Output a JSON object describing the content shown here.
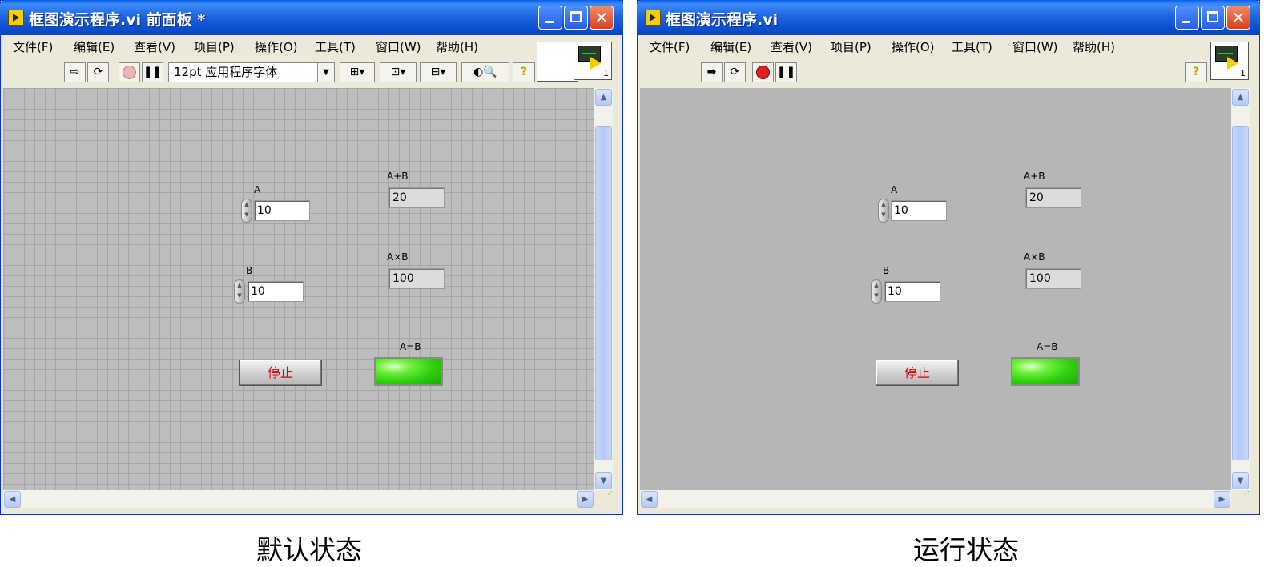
{
  "windows": [
    {
      "title": "框图演示程序.vi 前面板 *",
      "menus": [
        "文件(F)",
        "编辑(E)",
        "查看(V)",
        "项目(P)",
        "操作(O)",
        "工具(T)",
        "窗口(W)",
        "帮助(H)"
      ],
      "font_selector": "12pt 应用程序字体",
      "mode": "edit",
      "controls": {
        "a_label": "A",
        "a_value": "10",
        "b_label": "B",
        "b_value": "10",
        "sum_label": "A+B",
        "sum_value": "20",
        "product_label": "A×B",
        "product_value": "100",
        "equal_label": "A=B",
        "stop_label": "停止"
      },
      "led_color": "#2fcf10",
      "caption": "默认状态"
    },
    {
      "title": "框图演示程序.vi",
      "menus": [
        "文件(F)",
        "编辑(E)",
        "查看(V)",
        "项目(P)",
        "操作(O)",
        "工具(T)",
        "窗口(W)",
        "帮助(H)"
      ],
      "mode": "run",
      "controls": {
        "a_label": "A",
        "a_value": "10",
        "b_label": "B",
        "b_value": "10",
        "sum_label": "A+B",
        "sum_value": "20",
        "product_label": "A×B",
        "product_value": "100",
        "equal_label": "A=B",
        "stop_label": "停止"
      },
      "led_color": "#2fcf10",
      "caption": "运行状态"
    }
  ],
  "icon_pane_number": "1",
  "colors": {
    "title_bar": "#1f66e0",
    "edit_canvas": "#bdbdbd",
    "run_canvas": "#b6b6b6",
    "stop_text": "#e00000"
  }
}
